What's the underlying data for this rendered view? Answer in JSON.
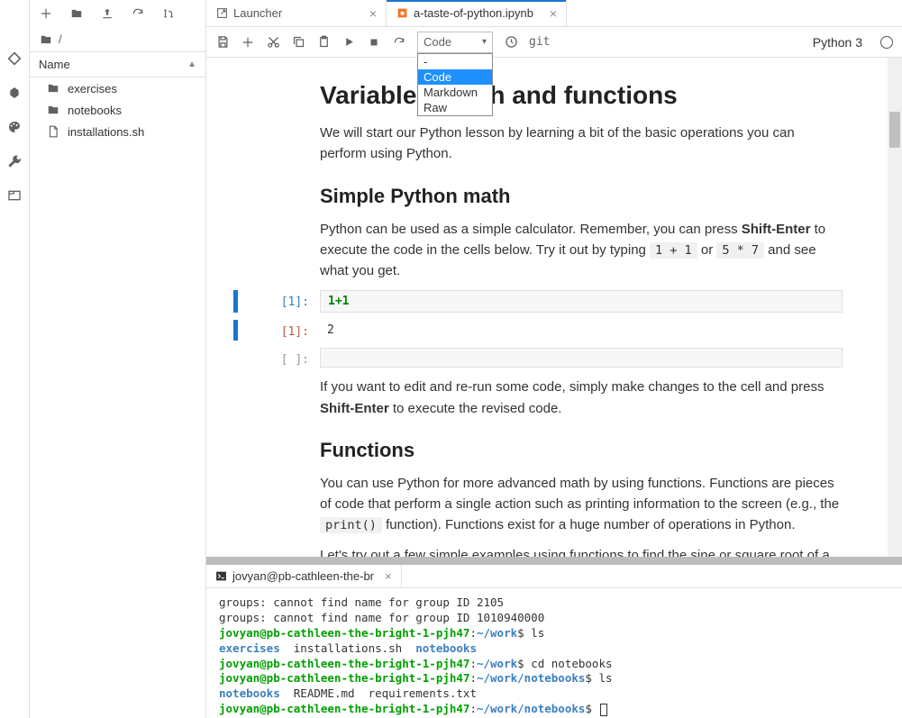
{
  "left_rail": [
    "git-diamond",
    "circle",
    "palette",
    "wrench",
    "tabs"
  ],
  "fb": {
    "toolbar": [
      "plus",
      "upload",
      "download",
      "refresh",
      "wand"
    ],
    "breadcrumb_icon": "folder",
    "breadcrumb": "/",
    "header": "Name",
    "items": [
      {
        "icon": "folder",
        "label": "exercises"
      },
      {
        "icon": "folder",
        "label": "notebooks"
      },
      {
        "icon": "file",
        "label": "installations.sh"
      }
    ]
  },
  "tabs": [
    {
      "icon": "launcher",
      "label": "Launcher",
      "active": false
    },
    {
      "icon": "notebook",
      "label": "a-taste-of-python.ipynb",
      "active": true
    }
  ],
  "nbtoolbar": {
    "icons": [
      "save",
      "add",
      "cut",
      "copy",
      "paste",
      "run",
      "stop",
      "restart"
    ],
    "celltype_selected": "Code",
    "celltype_options": [
      "-",
      "Code",
      "Markdown",
      "Raw"
    ],
    "extra": [
      "clock"
    ],
    "git_label": "git",
    "kernel": "Python 3"
  },
  "notebook": {
    "h1": "Variables, math and functions",
    "p1a": "We will start our Python lesson by learning a bit of the basic operations you can perform using Python.",
    "h2a": "Simple Python math",
    "p2a_pre": "Python can be used as a simple calculator. Remember, you can press ",
    "p2a_bold": "Shift-Enter",
    "p2a_mid": " to execute the code in the cells below. Try it out by typing ",
    "p2a_code1": "1 + 1",
    "p2a_or": " or ",
    "p2a_code2": "5 * 7",
    "p2a_end": " and see what you get.",
    "cell_in_prompt": "[1]:",
    "cell_in_code": "1+1",
    "cell_out_prompt": "[1]:",
    "cell_out_val": "2",
    "cell_empty_prompt": "[ ]:",
    "p3_pre": "If you want to edit and re-run some code, simply make changes to the cell and press ",
    "p3_bold": "Shift-Enter",
    "p3_end": " to execute the revised code.",
    "h2b": "Functions",
    "p4_pre": "You can use Python for more advanced math by using functions. Functions are pieces of code that perform a single action such as printing information to the screen (e.g., the ",
    "p4_code": "print()",
    "p4_end": " function). Functions exist for a huge number of operations in Python.",
    "p5": "Let's try out a few simple examples using functions to find the sine or square root of a value. You"
  },
  "terminal": {
    "tab_label": "jovyan@pb-cathleen-the-br",
    "lines": [
      {
        "t": "plain",
        "text": "groups: cannot find name for group ID 2105"
      },
      {
        "t": "plain",
        "text": "groups: cannot find name for group ID 1010940000"
      },
      {
        "t": "prompt",
        "user": "jovyan@pb-cathleen-the-bright-1-pjh47",
        "path": "~/work",
        "cmd": "ls"
      },
      {
        "t": "ls",
        "items": [
          {
            "n": "exercises",
            "d": true
          },
          {
            "n": "installations.sh",
            "d": false
          },
          {
            "n": "notebooks",
            "d": true
          }
        ]
      },
      {
        "t": "prompt",
        "user": "jovyan@pb-cathleen-the-bright-1-pjh47",
        "path": "~/work",
        "cmd": "cd notebooks"
      },
      {
        "t": "prompt",
        "user": "jovyan@pb-cathleen-the-bright-1-pjh47",
        "path": "~/work/notebooks",
        "cmd": "ls"
      },
      {
        "t": "ls",
        "items": [
          {
            "n": "notebooks",
            "d": true
          },
          {
            "n": "README.md",
            "d": false
          },
          {
            "n": "requirements.txt",
            "d": false
          }
        ]
      },
      {
        "t": "prompt",
        "user": "jovyan@pb-cathleen-the-bright-1-pjh47",
        "path": "~/work/notebooks",
        "cmd": "",
        "cursor": true
      }
    ]
  }
}
